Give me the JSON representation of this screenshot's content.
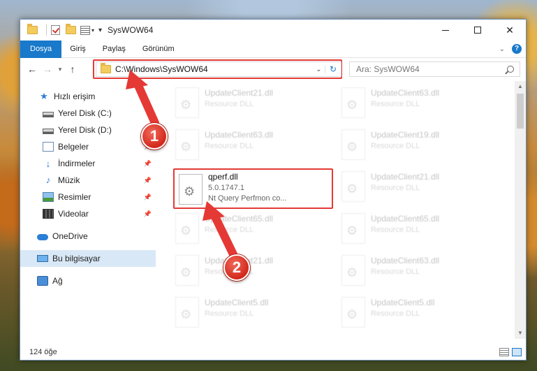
{
  "window": {
    "title": "SysWOW64"
  },
  "ribbon": {
    "tabs": [
      "Dosya",
      "Giriş",
      "Paylaş",
      "Görünüm"
    ],
    "help": "?"
  },
  "address": {
    "path": "C:\\Windows\\SysWOW64"
  },
  "search": {
    "placeholder": "Ara: SysWOW64"
  },
  "sidebar": {
    "items": [
      {
        "label": "Hızlı erişim",
        "icon": "star-icon"
      },
      {
        "label": "Yerel Disk (C:)",
        "icon": "drive-icon"
      },
      {
        "label": "Yerel Disk (D:)",
        "icon": "drive-icon"
      },
      {
        "label": "Belgeler",
        "icon": "documents-icon",
        "pinned": true
      },
      {
        "label": "İndirmeler",
        "icon": "downloads-icon",
        "pinned": true
      },
      {
        "label": "Müzik",
        "icon": "music-icon",
        "pinned": true
      },
      {
        "label": "Resimler",
        "icon": "pictures-icon",
        "pinned": true
      },
      {
        "label": "Videolar",
        "icon": "videos-icon",
        "pinned": true
      },
      {
        "label": "OneDrive",
        "icon": "onedrive-icon"
      },
      {
        "label": "Bu bilgisayar",
        "icon": "computer-icon",
        "selected": true
      },
      {
        "label": "Ağ",
        "icon": "network-icon"
      }
    ]
  },
  "files": {
    "left": [
      {
        "name": "UpdateClient21.dll",
        "type": "Resource DLL"
      },
      {
        "name": "UpdateClient63.dll",
        "type": "Resource DLL"
      },
      {
        "name": "qperf.dll",
        "version": "5.0.1747.1",
        "description": "Nt Query Perfmon co..."
      },
      {
        "name": "UpdateClient65.dll",
        "type": "Resource DLL"
      },
      {
        "name": "UpdateClient21.dll",
        "type": "Resource DLL"
      },
      {
        "name": "UpdateClient5.dll",
        "type": "Resource DLL"
      }
    ],
    "right": [
      {
        "name": "UpdateClient63.dll",
        "type": "Resource DLL"
      },
      {
        "name": "UpdateClient19.dll",
        "type": "Resource DLL"
      },
      {
        "name": "UpdateClient21.dll",
        "type": "Resource DLL"
      },
      {
        "name": "UpdateClient65.dll",
        "type": "Resource DLL"
      },
      {
        "name": "UpdateClient63.dll",
        "type": "Resource DLL"
      },
      {
        "name": "UpdateClient5.dll",
        "type": "Resource DLL"
      }
    ]
  },
  "status": {
    "count": "124 öğe"
  },
  "annotations": {
    "badge1": "1",
    "badge2": "2",
    "color": "#e53935"
  }
}
